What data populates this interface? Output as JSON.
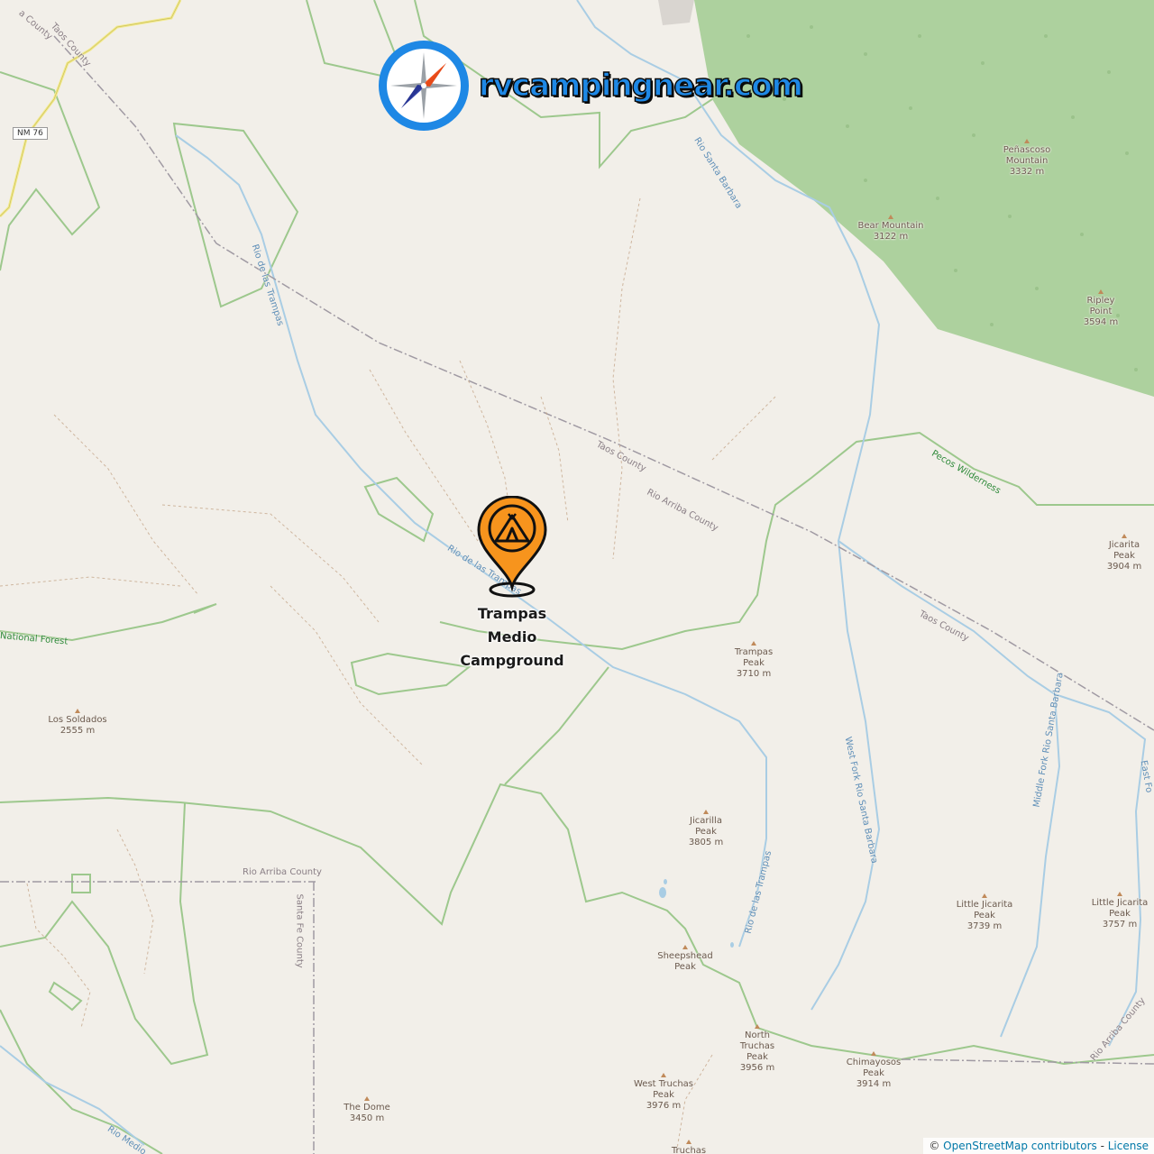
{
  "logo": {
    "text": "rvcampingnear.com",
    "icon": "compass-icon"
  },
  "campground": {
    "name_lines": [
      "Trampas",
      "Medio",
      "Campground"
    ],
    "icon": "tent-pin-icon"
  },
  "road_shield": "NM 76",
  "peaks": [
    {
      "name": "Peñascoso Mountain",
      "lines": [
        "Peñascoso",
        "Mountain",
        "3332 m"
      ]
    },
    {
      "name": "Bear Mountain",
      "lines": [
        "Bear Mountain",
        "3122 m"
      ]
    },
    {
      "name": "Ripley Point",
      "lines": [
        "Ripley",
        "Point",
        "3594 m"
      ]
    },
    {
      "name": "Jicarita Peak",
      "lines": [
        "Jicarita",
        "Peak",
        "3904 m"
      ]
    },
    {
      "name": "Trampas Peak",
      "lines": [
        "Trampas",
        "Peak",
        "3710 m"
      ]
    },
    {
      "name": "Los Soldados",
      "lines": [
        "Los Soldados",
        "2555 m"
      ]
    },
    {
      "name": "Jicarilla Peak",
      "lines": [
        "Jicarilla",
        "Peak",
        "3805 m"
      ]
    },
    {
      "name": "Little Jicarita Peak",
      "lines": [
        "Little Jicarita",
        "Peak",
        "3739 m"
      ]
    },
    {
      "name": "Little Jicarita Peak 2",
      "lines": [
        "Little Jicarita",
        "Peak",
        "3757 m"
      ]
    },
    {
      "name": "Sheepshead Peak",
      "lines": [
        "Sheepshead",
        "Peak"
      ]
    },
    {
      "name": "North Truchas Peak",
      "lines": [
        "North",
        "Truchas",
        "Peak",
        "3956 m"
      ]
    },
    {
      "name": "Chimayosos Peak",
      "lines": [
        "Chimayosos",
        "Peak",
        "3914 m"
      ]
    },
    {
      "name": "West Truchas Peak",
      "lines": [
        "West Truchas",
        "Peak",
        "3976 m"
      ]
    },
    {
      "name": "The Dome",
      "lines": [
        "The Dome",
        "3450 m"
      ]
    },
    {
      "name": "Truchas",
      "lines": [
        "Truchas"
      ]
    }
  ],
  "rivers": [
    "Rio de las Trampas",
    "Rio de las Trampas",
    "Rio de las Trampas",
    "Rio Santa Barbara",
    "West Fork Rio Santa Barbara",
    "Middle Fork Rio Santa Barbara",
    "East Fo",
    "Rio Medio"
  ],
  "admin_labels": [
    "Taos County",
    "Taos County",
    "Rio Arriba County",
    "Taos County",
    "Rio Arriba County",
    "Santa Fe County",
    "Rio Arriba County",
    "a County"
  ],
  "area_labels": [
    "Pecos Wilderness",
    "National Forest"
  ],
  "attribution": {
    "prefix": "© ",
    "osm": "OpenStreetMap contributors",
    "sep": " - ",
    "license": "License"
  },
  "colors": {
    "forest": "#add19e",
    "background": "#f2efe9",
    "water": "#a9cde4",
    "boundary": "#9dc88d",
    "pin": "#f7941d"
  }
}
